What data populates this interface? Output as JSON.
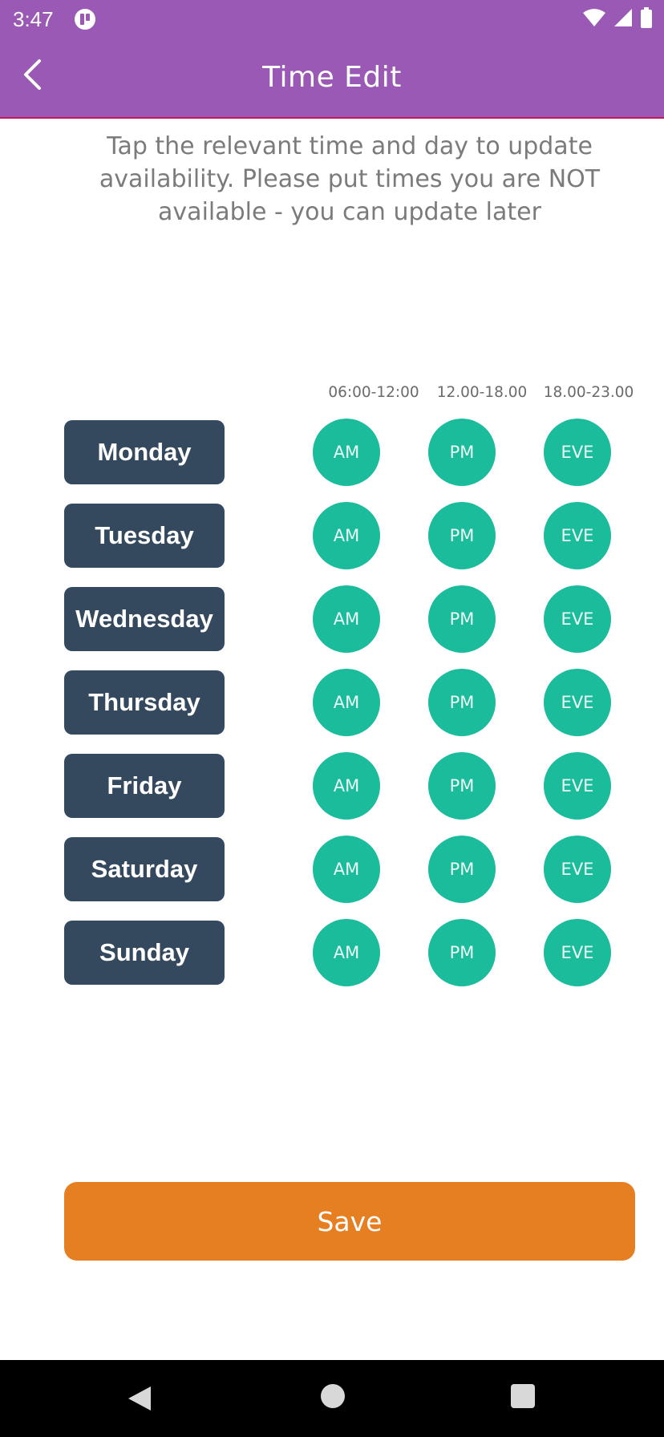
{
  "status_bar": {
    "time": "3:47",
    "icons": [
      "app-notification-icon",
      "wifi-icon",
      "cell-signal-icon",
      "battery-icon"
    ]
  },
  "app_bar": {
    "title": "Time Edit",
    "back_icon": "chevron-left-icon"
  },
  "instructions": "Tap the relevant time and day to update availability. Please put times you are NOT available - you can update later",
  "columns": [
    {
      "header": "06:00-12:00",
      "slot_label": "AM"
    },
    {
      "header": "12.00-18.00",
      "slot_label": "PM"
    },
    {
      "header": "18.00-23.00",
      "slot_label": "EVE"
    }
  ],
  "days": [
    {
      "label": "Monday",
      "slots": [
        "AM",
        "PM",
        "EVE"
      ]
    },
    {
      "label": "Tuesday",
      "slots": [
        "AM",
        "PM",
        "EVE"
      ]
    },
    {
      "label": "Wednesday",
      "slots": [
        "AM",
        "PM",
        "EVE"
      ]
    },
    {
      "label": "Thursday",
      "slots": [
        "AM",
        "PM",
        "EVE"
      ]
    },
    {
      "label": "Friday",
      "slots": [
        "AM",
        "PM",
        "EVE"
      ]
    },
    {
      "label": "Saturday",
      "slots": [
        "AM",
        "PM",
        "EVE"
      ]
    },
    {
      "label": "Sunday",
      "slots": [
        "AM",
        "PM",
        "EVE"
      ]
    }
  ],
  "save_label": "Save",
  "colors": {
    "brand_purple": "#9b59b6",
    "day_button": "#34495e",
    "slot_available": "#1abc9c",
    "save_orange": "#e67e22"
  },
  "nav_bar": {
    "icons": [
      "nav-back-icon",
      "nav-home-icon",
      "nav-recents-icon"
    ]
  }
}
